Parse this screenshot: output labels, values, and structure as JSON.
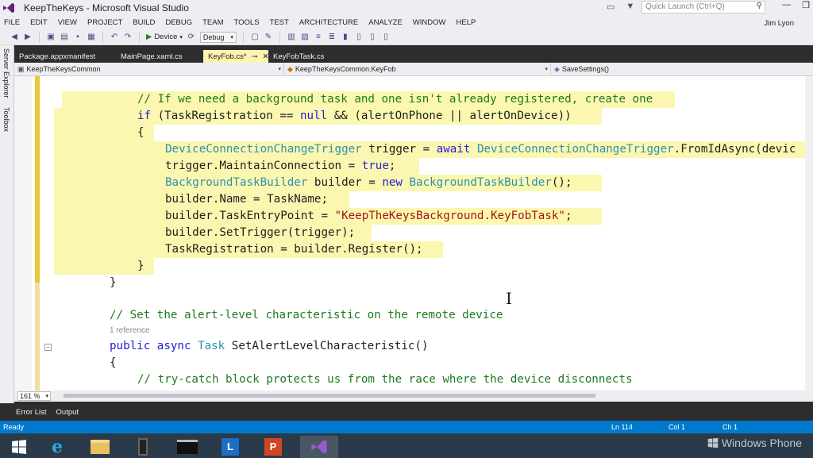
{
  "window": {
    "title": "KeepTheKeys - Microsoft Visual Studio",
    "quick_launch_placeholder": "Quick Launch (Ctrl+Q)",
    "user": "Jim Lyon"
  },
  "menu": [
    "FILE",
    "EDIT",
    "VIEW",
    "PROJECT",
    "BUILD",
    "DEBUG",
    "TEAM",
    "TOOLS",
    "TEST",
    "ARCHITECTURE",
    "ANALYZE",
    "WINDOW",
    "HELP"
  ],
  "toolbar": {
    "run_target": "Device",
    "configuration": "Debug"
  },
  "left_rail": [
    "Server Explorer",
    "Toolbox"
  ],
  "tabs": [
    {
      "label": "Package.appxmanifest"
    },
    {
      "label": "MainPage.xaml.cs"
    },
    {
      "label": "KeyFob.cs*",
      "close": "✕",
      "pin": "⊸"
    },
    {
      "label": "KeyFobTask.cs"
    }
  ],
  "navbar": {
    "project": "KeepTheKeysCommon",
    "type": "KeepTheKeysCommon.KeyFob",
    "member": "SaveSettings()"
  },
  "code": {
    "reference_hint": "1 reference"
  },
  "zoom": "161 %",
  "panels": [
    "Error List",
    "Output"
  ],
  "status": {
    "state": "Ready",
    "line": "Ln 114",
    "col": "Col 1",
    "ch": "Ch 1"
  },
  "taskbar": {
    "brand": "Windows Phone",
    "apps": [
      "start",
      "internet-explorer",
      "file-explorer",
      "phone-emulator",
      "command-prompt",
      "lync",
      "powerpoint",
      "visual-studio"
    ]
  },
  "colors": {
    "accent": "#007acc",
    "change_highlight": "#fcf7b0",
    "keyword": "#1f1fd6",
    "type": "#2b91af",
    "comment": "#1e7a1e",
    "string": "#a31515"
  }
}
